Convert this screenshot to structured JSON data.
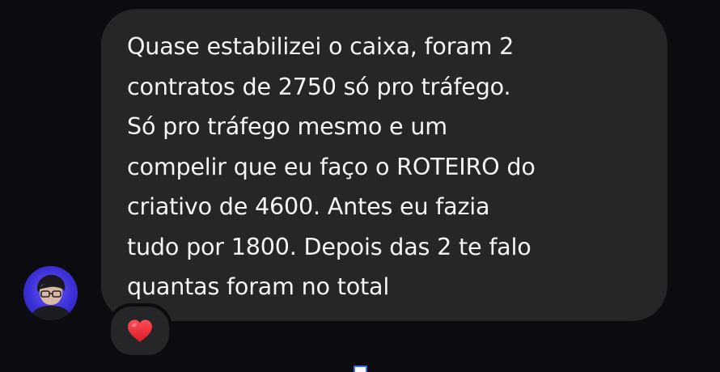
{
  "message": {
    "text": "Quase estabilizei o caixa, foram 2\ncontratos de 2750 só pro tráfego.\nSó pro tráfego mesmo e um\ncompelir que eu faço o ROTEIRO do\ncriativo de 4600. Antes eu fazia\ntudo por 1800. Depois das 2 te falo\nquantas foram no total"
  },
  "reaction": {
    "icon": "heart-icon",
    "color": "#e8242f"
  },
  "sender": {
    "avatar_icon": "avatar",
    "avatar_color": "#4a3cf0"
  },
  "colors": {
    "background": "#0c0c10",
    "bubble": "#262629",
    "text": "#f4f4f6"
  }
}
